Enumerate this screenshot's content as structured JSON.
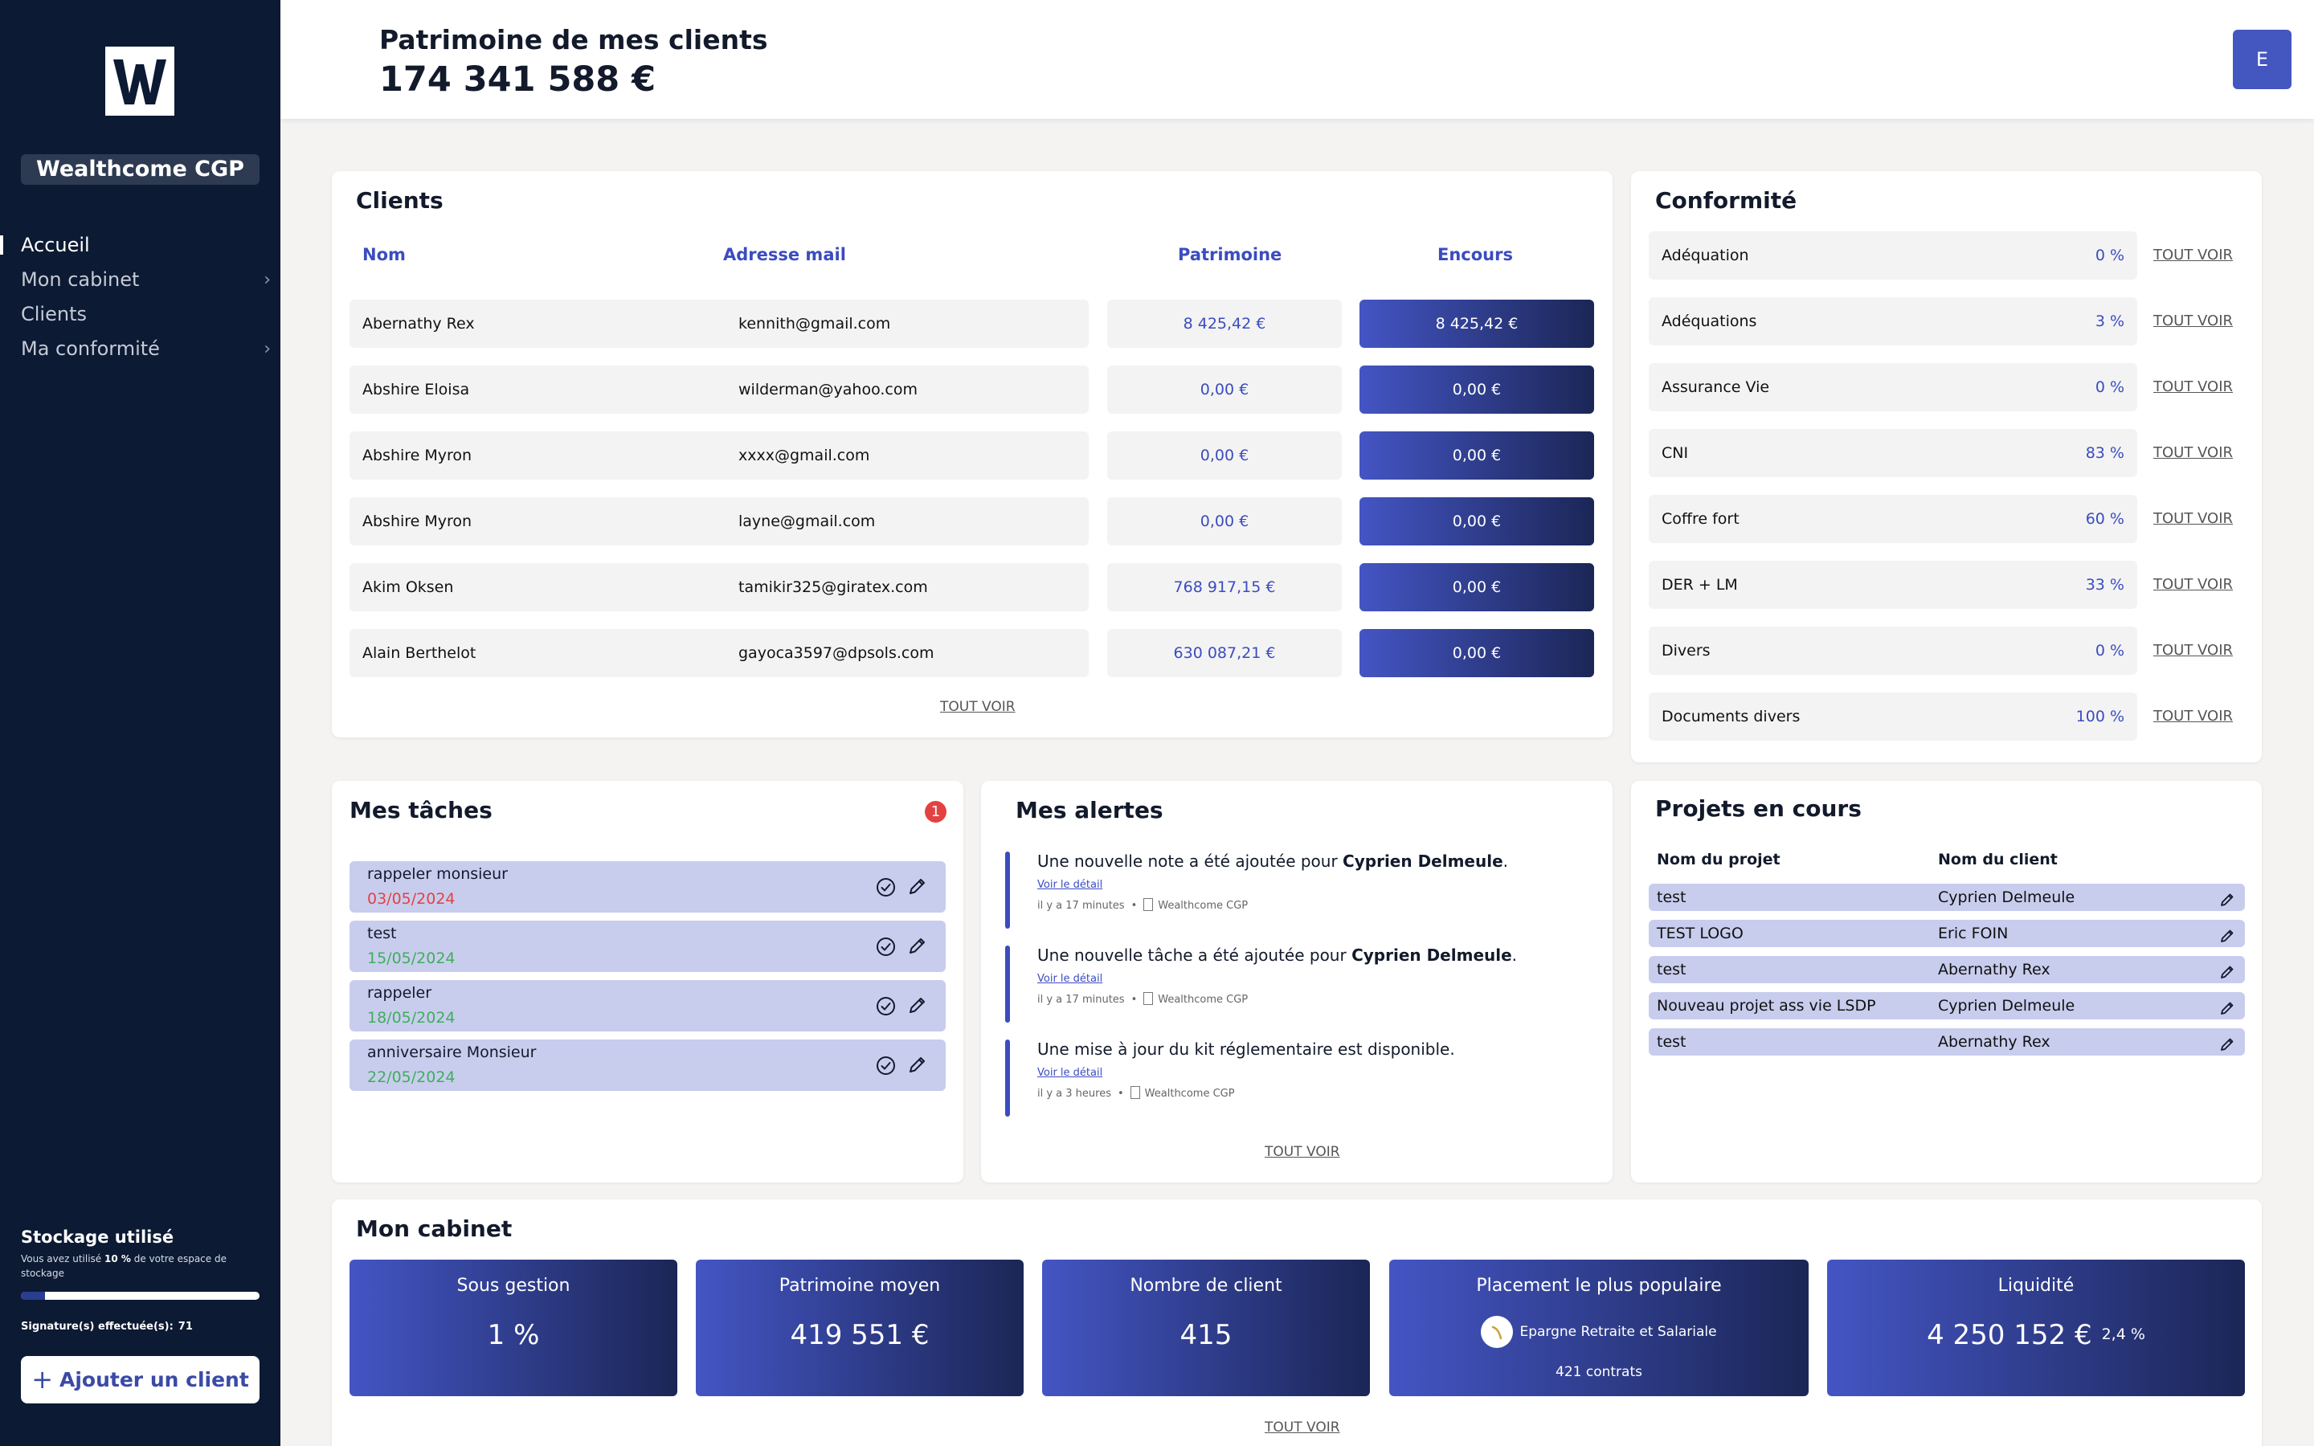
{
  "sidebar": {
    "org_name": "Wealthcome CGP",
    "nav": [
      {
        "label": "Accueil"
      },
      {
        "label": "Mon cabinet"
      },
      {
        "label": "Clients"
      },
      {
        "label": "Ma conformité"
      }
    ],
    "storage": {
      "title": "Stockage utilisé",
      "desc_prefix": "Vous avez utilisé ",
      "percent_label": "10 %",
      "desc_suffix": " de votre espace de stockage",
      "used_fraction": 0.1,
      "signatures_label": "Signature(s) effectuée(s):",
      "signatures_count": "71"
    },
    "add_client_label": "Ajouter un client"
  },
  "header": {
    "title": "Patrimoine de mes clients",
    "value": "174 341 588 €",
    "avatar_initial": "E"
  },
  "clients": {
    "title": "Clients",
    "columns": [
      "Nom",
      "Adresse mail",
      "Patrimoine",
      "Encours"
    ],
    "rows": [
      {
        "name": "Abernathy Rex",
        "email": "kennith@gmail.com",
        "patrimoine": "8 425,42 €",
        "encours": "8 425,42 €"
      },
      {
        "name": "Abshire Eloisa",
        "email": "wilderman@yahoo.com",
        "patrimoine": "0,00 €",
        "encours": "0,00 €"
      },
      {
        "name": "Abshire Myron",
        "email": "xxxx@gmail.com",
        "patrimoine": "0,00 €",
        "encours": "0,00 €"
      },
      {
        "name": "Abshire Myron",
        "email": "layne@gmail.com",
        "patrimoine": "0,00 €",
        "encours": "0,00 €"
      },
      {
        "name": "Akim Oksen",
        "email": "tamikir325@giratex.com",
        "patrimoine": "768 917,15 €",
        "encours": "0,00 €"
      },
      {
        "name": "Alain Berthelot",
        "email": "gayoca3597@dpsols.com",
        "patrimoine": "630 087,21 €",
        "encours": "0,00 €"
      }
    ],
    "see_all": "TOUT VOIR"
  },
  "conformite": {
    "title": "Conformité",
    "see_all": "TOUT VOIR",
    "rows": [
      {
        "label": "Adéquation",
        "pct": "0 %"
      },
      {
        "label": "Adéquations",
        "pct": "3 %"
      },
      {
        "label": "Assurance Vie",
        "pct": "0 %"
      },
      {
        "label": "CNI",
        "pct": "83 %"
      },
      {
        "label": "Coffre fort",
        "pct": "60 %"
      },
      {
        "label": "DER + LM",
        "pct": "33 %"
      },
      {
        "label": "Divers",
        "pct": "0 %"
      },
      {
        "label": "Documents divers",
        "pct": "100 %"
      }
    ]
  },
  "tasks": {
    "title": "Mes tâches",
    "badge": "1",
    "items": [
      {
        "label": "rappeler monsieur",
        "date": "03/05/2024",
        "date_color": "#e34242"
      },
      {
        "label": "test",
        "date": "15/05/2024",
        "date_color": "#3fae5a"
      },
      {
        "label": "rappeler",
        "date": "18/05/2024",
        "date_color": "#3fae5a"
      },
      {
        "label": "anniversaire Monsieur",
        "date": "22/05/2024",
        "date_color": "#3fae5a"
      }
    ]
  },
  "alerts": {
    "title": "Mes alertes",
    "see_all": "TOUT VOIR",
    "items": [
      {
        "text": "Une nouvelle note a été ajoutée pour ",
        "strong": "Cyprien Delmeule",
        "end": ".",
        "link": "Voir le détail",
        "time": "il y a 17 minutes",
        "source": "Wealthcome CGP"
      },
      {
        "text": "Une nouvelle tâche a été ajoutée pour ",
        "strong": "Cyprien Delmeule",
        "end": ".",
        "link": "Voir le détail",
        "time": "il y a 17 minutes",
        "source": "Wealthcome CGP"
      },
      {
        "text": "Une mise à jour du kit réglementaire est disponible.",
        "strong": "",
        "end": "",
        "link": "Voir le détail",
        "time": "il y a 3 heures",
        "source": "Wealthcome CGP"
      }
    ]
  },
  "projects": {
    "title": "Projets en cours",
    "col_project": "Nom du projet",
    "col_client": "Nom du client",
    "rows": [
      {
        "name": "test",
        "client": "Cyprien Delmeule"
      },
      {
        "name": "TEST LOGO",
        "client": "Eric FOIN"
      },
      {
        "name": "test",
        "client": "Abernathy Rex"
      },
      {
        "name": "Nouveau projet ass vie LSDP",
        "client": "Cyprien Delmeule"
      },
      {
        "name": "test",
        "client": "Abernathy Rex"
      }
    ]
  },
  "cabinet": {
    "title": "Mon cabinet",
    "see_all": "TOUT VOIR",
    "sous_gestion": {
      "label": "Sous gestion",
      "value": "1 %"
    },
    "patrimoine_moyen": {
      "label": "Patrimoine moyen",
      "value": "419 551 €"
    },
    "nombre_client": {
      "label": "Nombre de client",
      "value": "415"
    },
    "placement": {
      "label": "Placement le plus populaire",
      "name": "Epargne Retraite et Salariale",
      "contracts": "421 contrats"
    },
    "liquidite": {
      "label": "Liquidité",
      "value": "4 250 152 €",
      "pct": "2,4 %"
    }
  },
  "colors": {
    "sidebar_bg": "#0c1a33",
    "accent": "#3b4cc0",
    "gradient_start": "#4455c4",
    "gradient_end": "#1b2656",
    "task_bg": "#c8cdee",
    "overdue": "#e34242",
    "ok": "#3fae5a"
  },
  "icons": [
    "logo-w-icon",
    "chevron-right-icon",
    "plus-icon",
    "check-circle-icon",
    "pencil-icon",
    "building-icon"
  ]
}
